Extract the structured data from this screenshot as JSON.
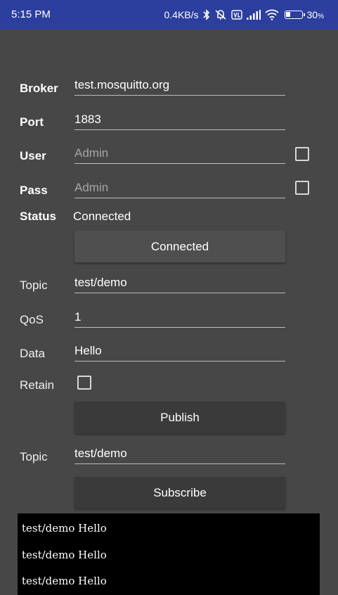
{
  "status_bar": {
    "time": "5:15 PM",
    "net_speed": "0.4KB/s",
    "battery_percent": "30",
    "battery_level": 0.3,
    "icons": [
      "bluetooth-icon",
      "mute-vibrate-icon",
      "volte-icon",
      "signal-icon",
      "wifi-icon",
      "battery-icon"
    ]
  },
  "connection": {
    "broker_label": "Broker",
    "broker_value": "test.mosquitto.org",
    "port_label": "Port",
    "port_value": "1883",
    "user_label": "User",
    "user_placeholder": "Admin",
    "user_checked": false,
    "pass_label": "Pass",
    "pass_placeholder": "Admin",
    "pass_checked": false,
    "status_label": "Status",
    "status_value": "Connected",
    "connect_button": "Connected"
  },
  "publish": {
    "topic_label": "Topic",
    "topic_value": "test/demo",
    "qos_label": "QoS",
    "qos_value": "1",
    "data_label": "Data",
    "data_value": "Hello",
    "retain_label": "Retain",
    "retain_checked": false,
    "publish_button": "Publish"
  },
  "subscribe": {
    "topic_label": "Topic",
    "topic_value": "test/demo",
    "subscribe_button": "Subscribe"
  },
  "messages": [
    "test/demo Hello",
    "test/demo Hello",
    "test/demo Hello"
  ],
  "colors": {
    "status_bar": "#2c3e9e",
    "background": "#474747",
    "log_background": "#000000"
  }
}
